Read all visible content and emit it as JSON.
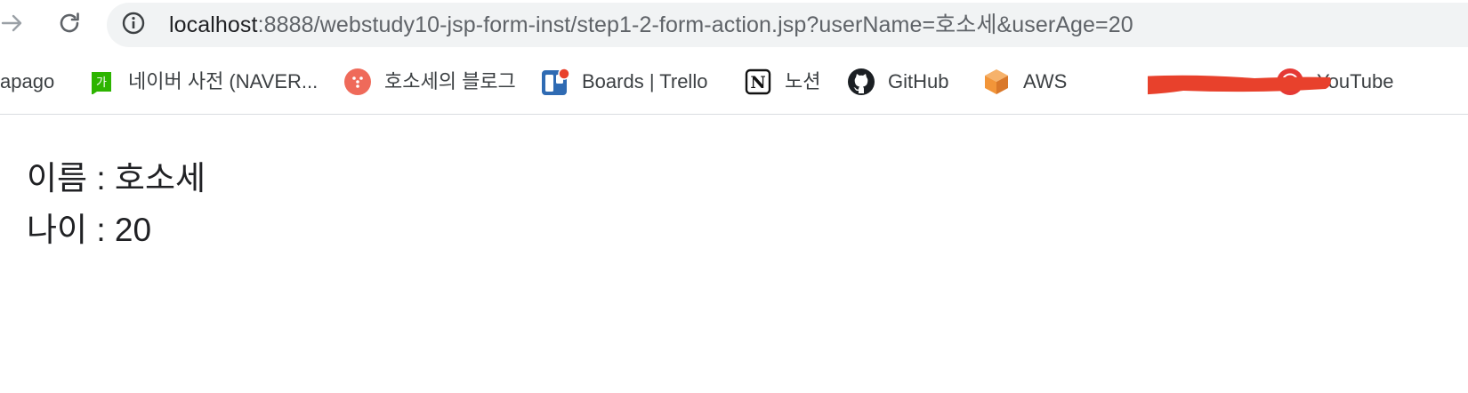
{
  "browser": {
    "url_host": "localhost",
    "url_rest": ":8888/webstudy10-jsp-form-inst/step1-2-form-action.jsp?userName=호소세&userAge=20",
    "icons": {
      "forward": "arrow-forward-icon",
      "reload": "reload-icon",
      "site_info": "info-icon"
    }
  },
  "bookmarks": [
    {
      "label": "apago",
      "icon": "none"
    },
    {
      "label": "네이버 사전 (NAVER...",
      "icon": "naver-dictionary-icon",
      "icon_text": "가",
      "color": "#2db400"
    },
    {
      "label": "호소세의 블로그",
      "icon": "blog-icon",
      "color": "#ef6a5a"
    },
    {
      "label": "Boards | Trello",
      "icon": "trello-icon",
      "color": "#2f6bb3"
    },
    {
      "label": "노션",
      "icon": "notion-icon",
      "icon_text": "N"
    },
    {
      "label": "GitHub",
      "icon": "github-icon"
    },
    {
      "label": "AWS",
      "icon": "aws-cube-icon",
      "color": "#f29539"
    },
    {
      "label": "",
      "icon": "redacted-scribble",
      "color": "#e8412c"
    },
    {
      "label": "YouTube",
      "icon": "youtube-icon",
      "color": "#e53935"
    }
  ],
  "page": {
    "name_line": "이름 : 호소세",
    "age_line": "나이 : 20"
  }
}
